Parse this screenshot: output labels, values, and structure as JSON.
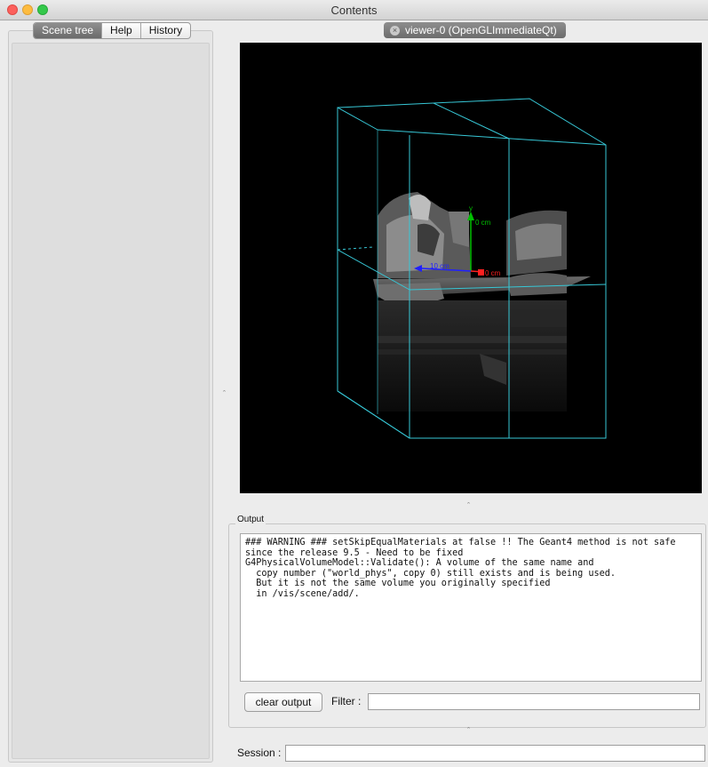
{
  "window": {
    "title": "Contents"
  },
  "left_tabs": [
    {
      "label": "Scene tree",
      "active": true
    },
    {
      "label": "Help",
      "active": false
    },
    {
      "label": "History",
      "active": false
    }
  ],
  "viewer": {
    "tab_label": "viewer-0 (OpenGLImmediateQt)"
  },
  "axes": {
    "y_label": "y",
    "y_value": "0 cm",
    "x_value": "0 cm",
    "z_value": "10 cm",
    "colors": {
      "y": "#00c000",
      "x": "#ff2020",
      "z": "#2020ff",
      "frame": "#37c7d6"
    }
  },
  "output": {
    "label": "Output",
    "text": "### WARNING ### setSkipEqualMaterials at false !! The Geant4 method is not safe\nsince the release 9.5 - Need to be fixed\nG4PhysicalVolumeModel::Validate(): A volume of the same name and\n  copy number (\"world_phys\", copy 0) still exists and is being used.\n  But it is not the same volume you originally specified\n  in /vis/scene/add/.",
    "clear_button": "clear output",
    "filter_label": "Filter :",
    "filter_value": ""
  },
  "session": {
    "label": "Session :",
    "value": ""
  }
}
